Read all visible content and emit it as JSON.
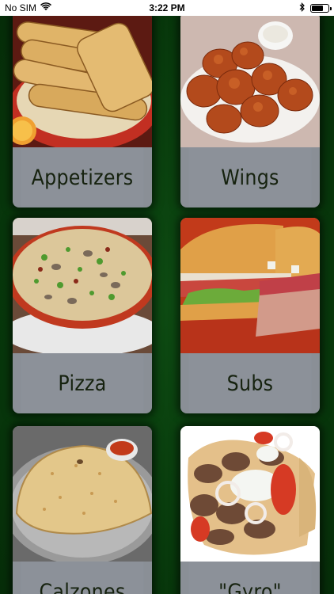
{
  "status_bar": {
    "carrier": "No SIM",
    "time": "3:22 PM"
  },
  "menu": {
    "categories": [
      {
        "label": "Appetizers",
        "icon": "breadsticks-photo"
      },
      {
        "label": "Wings",
        "icon": "wings-photo"
      },
      {
        "label": "Pizza",
        "icon": "pizza-photo"
      },
      {
        "label": "Subs",
        "icon": "sub-sandwich-photo"
      },
      {
        "label": "Calzones",
        "icon": "calzone-photo"
      },
      {
        "label": "\"Gyro\"",
        "icon": "gyro-photo"
      }
    ]
  },
  "colors": {
    "background_green": "#0b4410",
    "label_background": "#8c9199",
    "label_text": "#16220f"
  }
}
